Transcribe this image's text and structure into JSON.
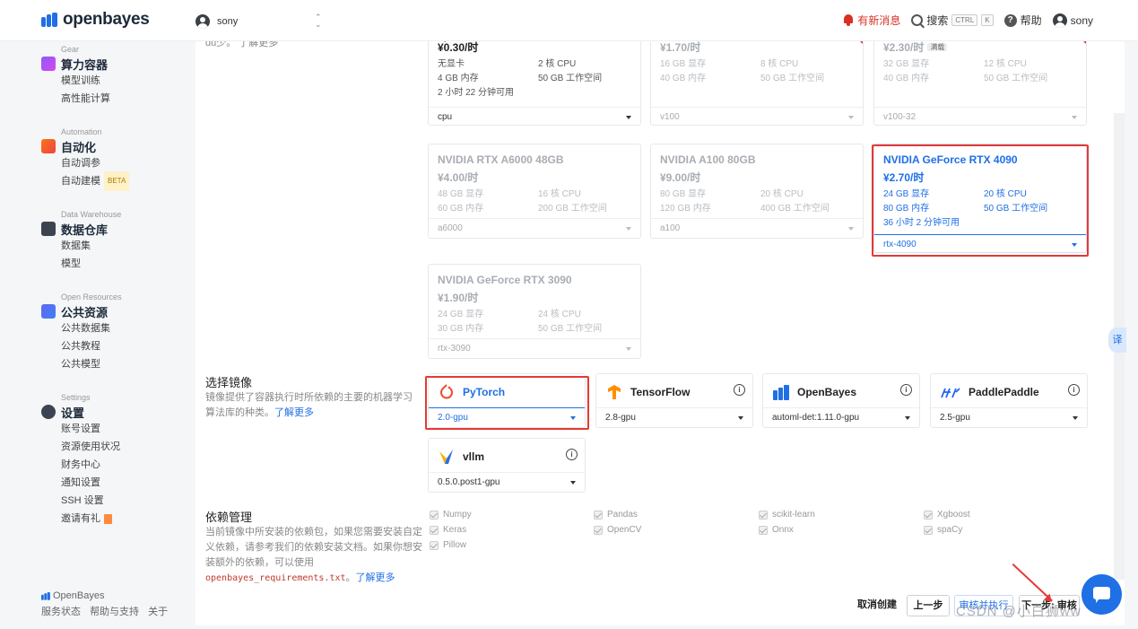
{
  "brand": "openbayes",
  "header": {
    "user": "sony",
    "notifications": "有新消息",
    "search": "搜索",
    "search_kbd1": "CTRL",
    "search_kbd2": "K",
    "help": "帮助",
    "account": "sony"
  },
  "sidebar": {
    "groups": [
      {
        "eyebrow": "Gear",
        "title": "算力容器",
        "items": [
          "模型训练",
          "高性能计算"
        ]
      },
      {
        "eyebrow": "Automation",
        "title": "自动化",
        "items": [
          "自动调参",
          "自动建模"
        ],
        "badge": "BETA"
      },
      {
        "eyebrow": "Data Warehouse",
        "title": "数据仓库",
        "items": [
          "数据集",
          "模型"
        ]
      },
      {
        "eyebrow": "Open Resources",
        "title": "公共资源",
        "items": [
          "公共数据集",
          "公共教程",
          "公共模型"
        ]
      },
      {
        "eyebrow": "Settings",
        "title": "设置",
        "items": [
          "账号设置",
          "资源使用状况",
          "财务中心",
          "通知设置",
          "SSH 设置",
          "邀请有礼"
        ]
      }
    ],
    "footer_brand": "OpenBayes",
    "footer_links": [
      "服务状态",
      "帮助与支持",
      "关于"
    ]
  },
  "top_fragment": {
    "desc": "du少。 了解更多",
    "cpu_label": "cpu"
  },
  "gpu_cards": [
    {
      "name": "",
      "price": "¥0.30/时",
      "spec1": "无显卡",
      "spec2": "2 核 CPU",
      "spec3": "4 GB 内存",
      "spec4": "50 GB 工作空间",
      "avail": "2 小时 22 分钟可用",
      "select": "cpu",
      "state": "normal"
    },
    {
      "name": "",
      "price": "¥1.70/时",
      "spec1": "16 GB 显存",
      "spec2": "8 核 CPU",
      "spec3": "40 GB 内存",
      "spec4": "50 GB 工作空间",
      "avail": "",
      "select": "v100",
      "state": "dim"
    },
    {
      "name": "",
      "price": "¥2.30/时",
      "badge": "满载",
      "spec1": "32 GB 显存",
      "spec2": "12 核 CPU",
      "spec3": "40 GB 内存",
      "spec4": "50 GB 工作空间",
      "avail": "",
      "select": "v100-32",
      "state": "dim"
    },
    {
      "name": "NVIDIA RTX A6000 48GB",
      "price": "¥4.00/时",
      "spec1": "48 GB 显存",
      "spec2": "16 核 CPU",
      "spec3": "60 GB 内存",
      "spec4": "200 GB 工作空间",
      "avail": "",
      "select": "a6000",
      "state": "dim"
    },
    {
      "name": "NVIDIA A100 80GB",
      "price": "¥9.00/时",
      "spec1": "80 GB 显存",
      "spec2": "20 核 CPU",
      "spec3": "120 GB 内存",
      "spec4": "400 GB 工作空间",
      "avail": "",
      "select": "a100",
      "state": "dim"
    },
    {
      "name": "NVIDIA GeForce RTX 4090",
      "price": "¥2.70/时",
      "spec1": "24 GB 显存",
      "spec2": "20 核 CPU",
      "spec3": "80 GB 内存",
      "spec4": "50 GB 工作空间",
      "avail": "36 小时 2 分钟可用",
      "select": "rtx-4090",
      "state": "selected"
    },
    {
      "name": "NVIDIA GeForce RTX 3090",
      "price": "¥1.90/时",
      "spec1": "24 GB 显存",
      "spec2": "24 核 CPU",
      "spec3": "30 GB 内存",
      "spec4": "50 GB 工作空间",
      "avail": "",
      "select": "rtx-3090",
      "state": "dim"
    }
  ],
  "image_section": {
    "title": "选择镜像",
    "desc": "镜像提供了容器执行时所依赖的主要的机器学习算法库的种类。",
    "link": "了解更多",
    "images": [
      {
        "name": "PyTorch",
        "select": "2.0-gpu",
        "icon": "pytorch-icon"
      },
      {
        "name": "TensorFlow",
        "select": "2.8-gpu",
        "icon": "tensorflow-icon"
      },
      {
        "name": "OpenBayes",
        "select": "automl-det:1.11.0-gpu",
        "icon": "openbayes-icon"
      },
      {
        "name": "PaddlePaddle",
        "select": "2.5-gpu",
        "icon": "paddle-icon"
      },
      {
        "name": "vllm",
        "select": "0.5.0.post1-gpu",
        "icon": "vllm-icon"
      }
    ]
  },
  "deps_section": {
    "title": "依赖管理",
    "desc": "当前镜像中所安装的依赖包，如果您需要安装自定义依赖，请参考我们的依赖安装文档。如果你想安装额外的依赖，可以使用",
    "file": "openbayes_requirements.txt",
    "link": "了解更多",
    "packages": [
      "Numpy",
      "Pandas",
      "scikit-learn",
      "Xgboost",
      "Keras",
      "OpenCV",
      "Onnx",
      "spaCy",
      "Pillow"
    ]
  },
  "actions": {
    "cancel": "取消创建",
    "prev": "上一步",
    "run": "审核并执行",
    "next": "下一步: 审核"
  },
  "side_tab": "译",
  "watermark": "CSDN @小白狮ww",
  "colors": {
    "accent": "#1f6fe5",
    "alert": "#d93025",
    "frame": "#e53935"
  }
}
